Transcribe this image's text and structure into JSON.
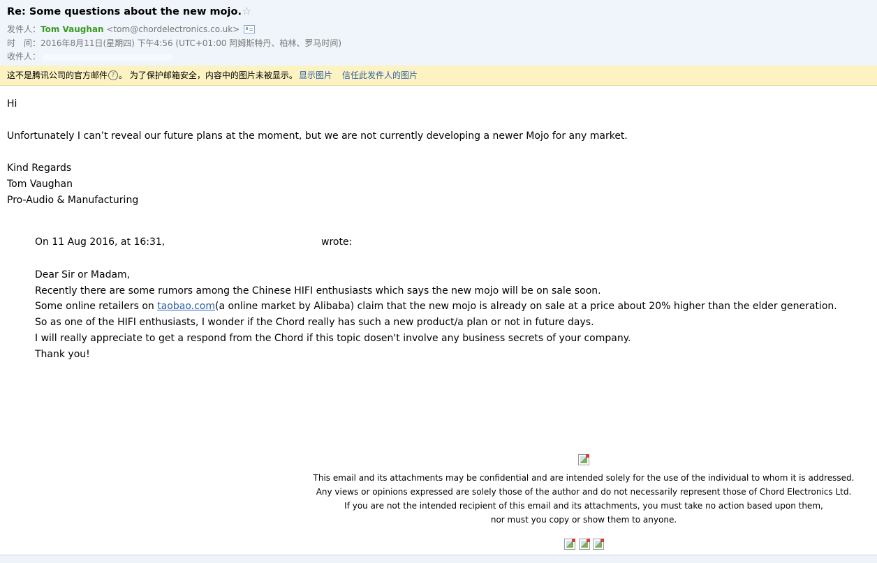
{
  "header": {
    "subject": "Re: Some questions about the new mojo.",
    "star_icon": "☆",
    "from_label": "发件人：",
    "sender_name": "Tom Vaughan",
    "sender_email": "<tom@chordelectronics.co.uk>",
    "time_label": "时　间：",
    "time_value": "2016年8月11日(星期四) 下午4:56 (UTC+01:00 阿姆斯特丹、柏林、罗马时间)",
    "to_label": "收件人："
  },
  "warning": {
    "text_before": "这不是腾讯公司的官方邮件",
    "help_icon": "?",
    "text_after": "。 为了保护邮箱安全，内容中的图片未被显示。",
    "show_images": "显示图片",
    "trust_sender": "信任此发件人的图片"
  },
  "body": {
    "greeting": "Hi",
    "message": "Unfortunately I can’t reveal our future plans at the moment, but we are not currently developing a newer Mojo for any market.",
    "sign_regards": "Kind Regards",
    "sign_name": "Tom Vaughan",
    "sign_dept": "Pro-Audio & Manufacturing"
  },
  "quote": {
    "on_date": "On 11 Aug 2016, at 16:31,",
    "wrote": "wrote:",
    "salutation": "Dear Sir or Madam,",
    "line1": "Recently there are some rumors among the Chinese HIFI enthusiasts which says the new mojo will be on sale soon.",
    "line2_before": "Some online retailers on ",
    "line2_link": "taobao.com",
    "line2_after": "(a online market by Alibaba) claim that the new mojo is already on sale at a price about 20% higher than the elder generation.",
    "line3": "So as one of the HIFI enthusiasts,  I wonder if the Chord really has such a new product/a plan or not in future days.",
    "line4": "I will really appreciate to get a respond from the Chord if this topic dosen't involve any business secrets of your company.",
    "line5": "Thank you!"
  },
  "footer": {
    "disclaimer1": "This email and its attachments may be confidential and are intended solely for the use of the individual to whom it is addressed.",
    "disclaimer2": "Any views or opinions expressed are solely those of the author and do not necessarily represent those of Chord Electronics Ltd.",
    "disclaimer3": "If you are not the intended recipient of this email and its attachments, you must take no action based upon them,",
    "disclaimer4": "nor must you copy or show them to anyone."
  },
  "colors": {
    "header_bg": "#eff5fb",
    "warning_bg": "#fdf3c2",
    "sender_name": "#3d9a23",
    "link": "#2a5ea8"
  }
}
